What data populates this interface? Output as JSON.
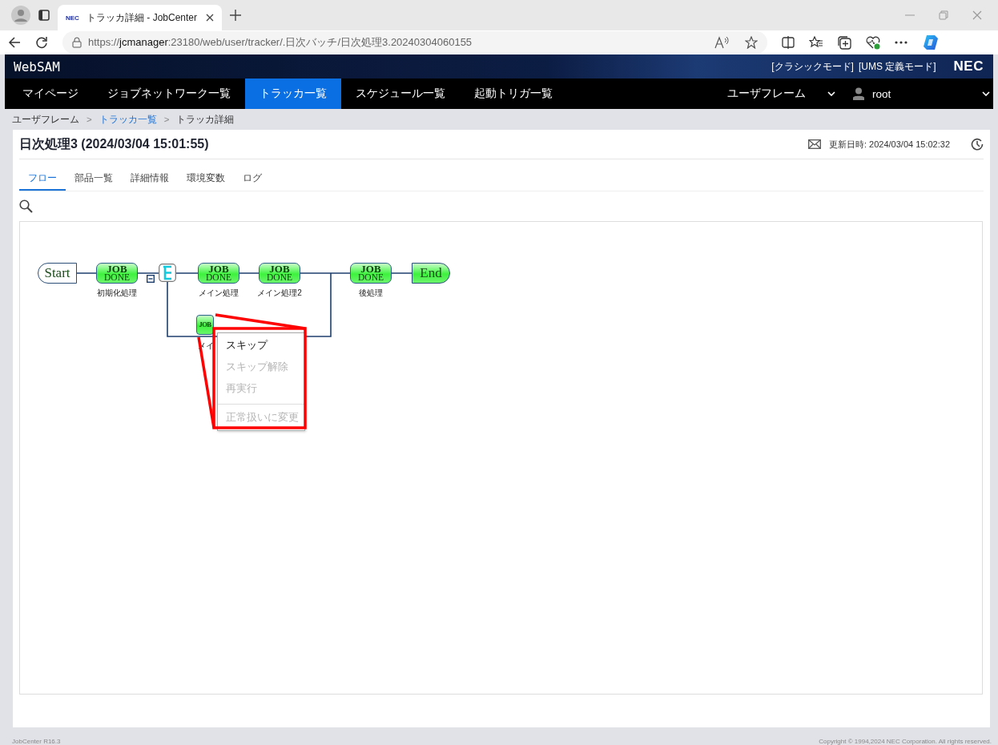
{
  "browser": {
    "tab_title": "トラッカ詳細 - JobCenter",
    "favicon_text": "NEC",
    "url_prefix": "https://",
    "url_host": "jcmanager",
    "url_rest": ":23180/web/user/tracker/.日次バッチ/日次処理3.20240304060155"
  },
  "header": {
    "product": "WebSAM",
    "links": [
      "[クラシックモード]",
      "[UMS 定義モード]"
    ],
    "logo": "NEC"
  },
  "nav": {
    "items": [
      {
        "label": "マイページ",
        "selected": false
      },
      {
        "label": "ジョブネットワーク一覧",
        "selected": false
      },
      {
        "label": "トラッカ一覧",
        "selected": true
      },
      {
        "label": "スケジュール一覧",
        "selected": false
      },
      {
        "label": "起動トリガ一覧",
        "selected": false
      }
    ],
    "user_frame": "ユーザフレーム",
    "user": "root"
  },
  "breadcrumb": [
    {
      "label": "ユーザフレーム",
      "link": false
    },
    {
      "label": ">",
      "kind": "separator"
    },
    {
      "label": "トラッカ一覧",
      "link": true
    },
    {
      "label": ">",
      "kind": "separator"
    },
    {
      "label": "トラッカ詳細",
      "link": false
    }
  ],
  "page": {
    "title": "日次処理3 (2024/03/04 15:01:55)",
    "updated": "更新日時: 2024/03/04 15:02:32"
  },
  "tabs": [
    {
      "label": "フロー",
      "selected": true
    },
    {
      "label": "部品一覧",
      "selected": false
    },
    {
      "label": "詳細情報",
      "selected": false
    },
    {
      "label": "環境変数",
      "selected": false
    },
    {
      "label": "ログ",
      "selected": false
    }
  ],
  "flow": {
    "nodes": [
      {
        "kind": "start",
        "label": "Start"
      },
      {
        "kind": "job",
        "title": "JOB",
        "status": "DONE",
        "name": "初期化処理"
      },
      {
        "kind": "branch"
      },
      {
        "kind": "job",
        "title": "JOB",
        "status": "DONE",
        "name": "メイン処理"
      },
      {
        "kind": "job",
        "title": "JOB",
        "status": "DONE",
        "name": "メイン処理2"
      },
      {
        "kind": "job",
        "title": "JOB",
        "status": "DONE",
        "name": "後処理"
      },
      {
        "kind": "end",
        "label": "End"
      }
    ],
    "sub_job": {
      "kind": "job",
      "title": "JOB",
      "name": "メイ"
    }
  },
  "context_menu": {
    "items": [
      {
        "label": "スキップ",
        "disabled": false,
        "separator_before": false
      },
      {
        "label": "スキップ解除",
        "disabled": true,
        "separator_before": false
      },
      {
        "label": "再実行",
        "disabled": true,
        "separator_before": false
      },
      {
        "label": "正常扱いに変更",
        "disabled": true,
        "separator_before": true
      }
    ]
  },
  "footer": {
    "version": "JobCenter R16.3",
    "copyright": "Copyright © 1994,2024 NEC Corporation. All rights reserved."
  }
}
